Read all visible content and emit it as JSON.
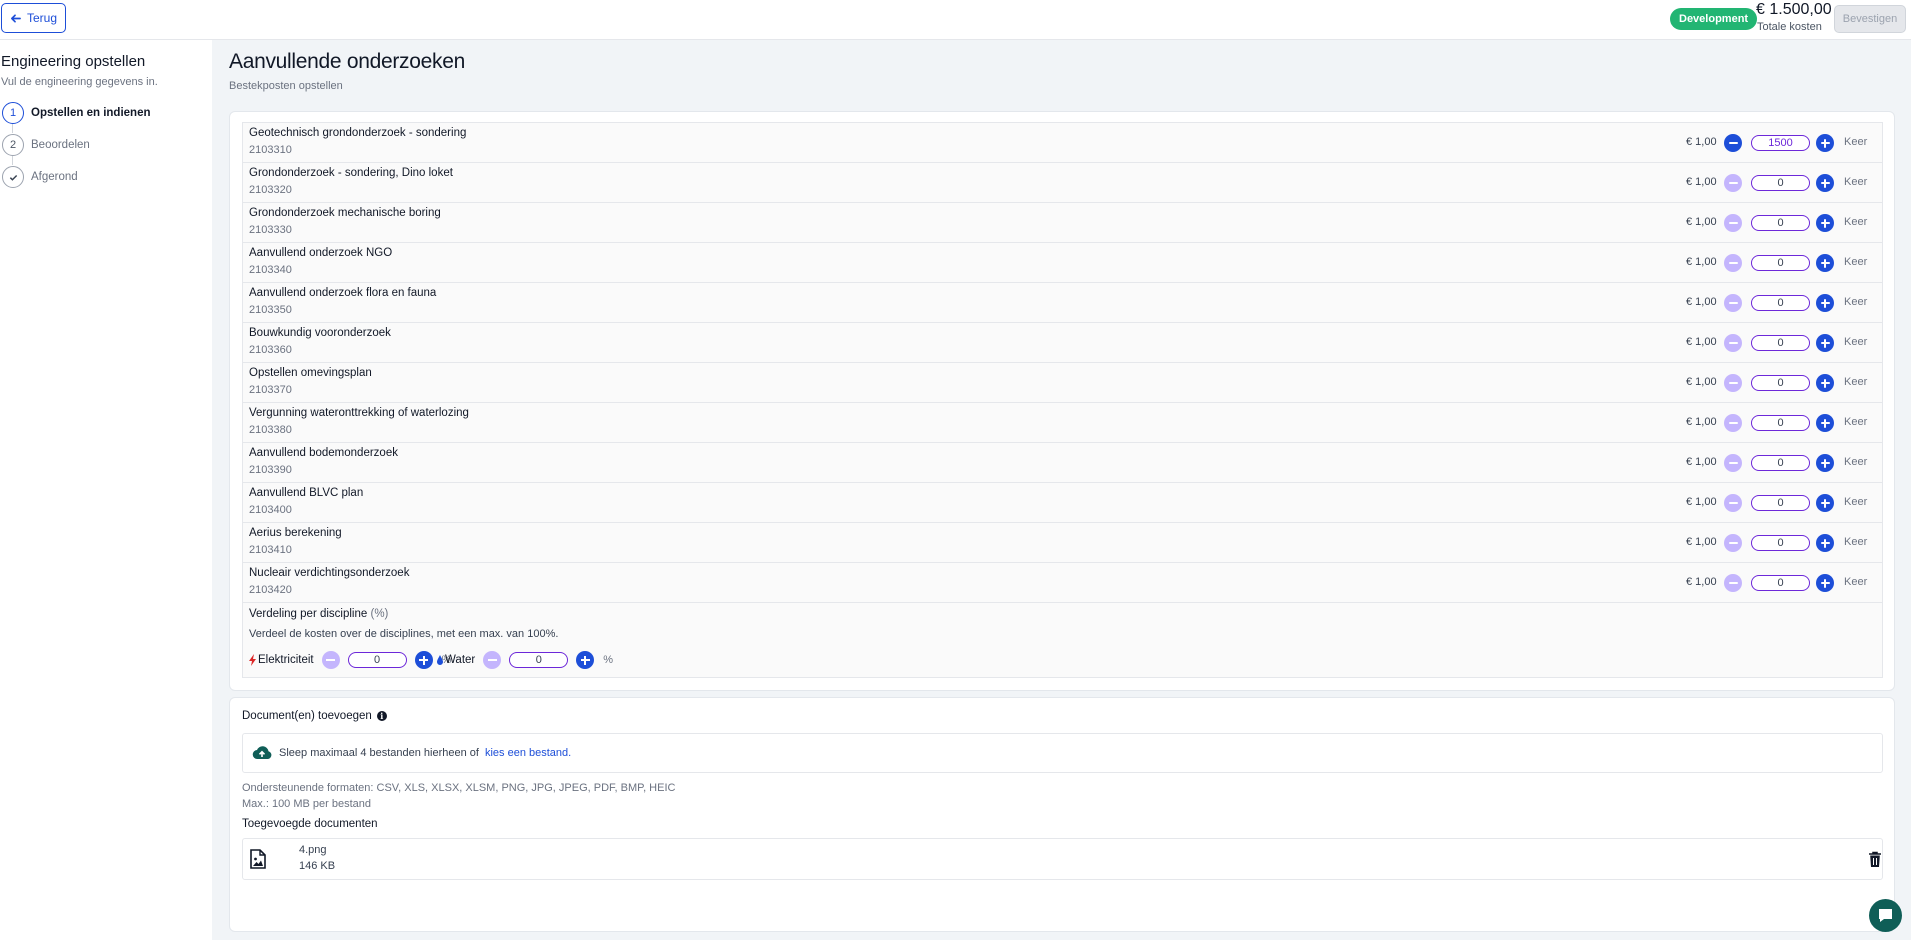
{
  "topbar": {
    "back_label": "Terug",
    "env_badge": "Development",
    "total_amount": "€ 1.500,00",
    "total_label": "Totale kosten",
    "confirm_label": "Bevestigen"
  },
  "sidebar": {
    "title": "Engineering opstellen",
    "subtitle": "Vul de engineering gegevens in.",
    "steps": [
      {
        "number": "1",
        "label": "Opstellen en indienen"
      },
      {
        "number": "2",
        "label": "Beoordelen"
      },
      {
        "number": "",
        "label": "Afgerond"
      }
    ]
  },
  "main": {
    "title": "Aanvullende onderzoeken",
    "subtitle": "Bestekposten opstellen"
  },
  "items": [
    {
      "name": "Geotechnisch grondonderzoek - sondering",
      "code": "2103310",
      "price": "€ 1,00",
      "qty": "1500",
      "unit": "Keer"
    },
    {
      "name": "Grondonderzoek - sondering, Dino loket",
      "code": "2103320",
      "price": "€ 1,00",
      "qty": "0",
      "unit": "Keer"
    },
    {
      "name": "Grondonderzoek mechanische boring",
      "code": "2103330",
      "price": "€ 1,00",
      "qty": "0",
      "unit": "Keer"
    },
    {
      "name": "Aanvullend onderzoek NGO",
      "code": "2103340",
      "price": "€ 1,00",
      "qty": "0",
      "unit": "Keer"
    },
    {
      "name": "Aanvullend onderzoek flora en fauna",
      "code": "2103350",
      "price": "€ 1,00",
      "qty": "0",
      "unit": "Keer"
    },
    {
      "name": "Bouwkundig vooronderzoek",
      "code": "2103360",
      "price": "€ 1,00",
      "qty": "0",
      "unit": "Keer"
    },
    {
      "name": "Opstellen omevingsplan",
      "code": "2103370",
      "price": "€ 1,00",
      "qty": "0",
      "unit": "Keer"
    },
    {
      "name": "Vergunning wateronttrekking of waterlozing",
      "code": "2103380",
      "price": "€ 1,00",
      "qty": "0",
      "unit": "Keer"
    },
    {
      "name": "Aanvullend bodemonderzoek",
      "code": "2103390",
      "price": "€ 1,00",
      "qty": "0",
      "unit": "Keer"
    },
    {
      "name": "Aanvullend BLVC plan",
      "code": "2103400",
      "price": "€ 1,00",
      "qty": "0",
      "unit": "Keer"
    },
    {
      "name": "Aerius berekening",
      "code": "2103410",
      "price": "€ 1,00",
      "qty": "0",
      "unit": "Keer"
    },
    {
      "name": "Nucleair verdichtingsonderzoek",
      "code": "2103420",
      "price": "€ 1,00",
      "qty": "0",
      "unit": "Keer"
    }
  ],
  "discipline": {
    "title": "Verdeling per discipline",
    "title_suffix": "(%)",
    "description": "Verdeel de kosten over de disciplines, met een max. van 100%.",
    "items": [
      {
        "label": "Elektriciteit",
        "value": "0",
        "unit": "%",
        "icon": "lightning-icon"
      },
      {
        "label": "Water",
        "value": "0",
        "unit": "%",
        "icon": "water-drop-icon"
      }
    ]
  },
  "documents": {
    "title": "Document(en) toevoegen",
    "drop_text": "Sleep maximaal 4 bestanden hierheen of",
    "drop_link": "kies een bestand.",
    "formats": "Ondersteunende formaten:  CSV, XLS, XLSX, XLSM, PNG, JPG, JPEG, PDF, BMP, HEIC",
    "max_size": "Max.: 100 MB per bestand",
    "added_title": "Toegevoegde documenten",
    "files": [
      {
        "name": "4.png",
        "size": "146 KB"
      }
    ]
  },
  "colors": {
    "accent": "#1d4ed8",
    "badge": "#22b573",
    "minus_disabled": "#c4b5fd",
    "chat": "#0f5e57"
  }
}
